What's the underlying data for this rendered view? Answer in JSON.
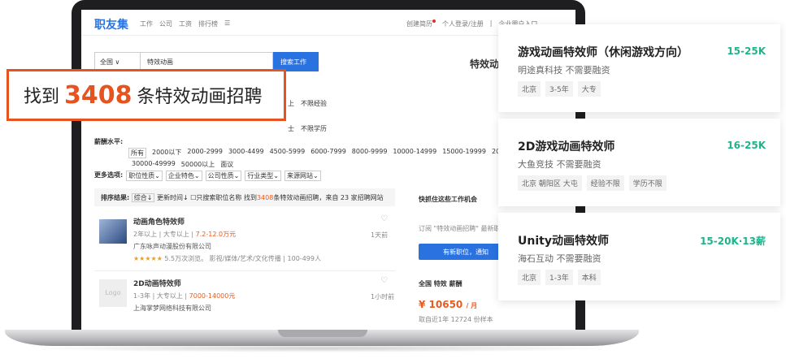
{
  "site": {
    "logo": "职友集",
    "nav": [
      "工作",
      "公司",
      "工资",
      "排行榜",
      "☰"
    ],
    "right": [
      "创建简历",
      "个人登录/注册",
      "|",
      "企业用户入口"
    ]
  },
  "search": {
    "city": "全国 ∨",
    "keyword": "特效动画",
    "button": "搜索工作",
    "right_title": "特效动"
  },
  "filters": {
    "exp_tail": [
      "上",
      "不限经验"
    ],
    "edu_tail": [
      "士",
      "不限学历"
    ],
    "salary_label": "薪酬水平:",
    "salary_row1": [
      "所有",
      "2000以下",
      "2000-2999",
      "3000-4499",
      "4500-5999",
      "6000-7999",
      "8000-9999",
      "10000-14999",
      "15000-19999",
      "200"
    ],
    "salary_row2": [
      "30000-49999",
      "50000以上",
      "面议"
    ],
    "more_label": "更多选项:",
    "more": [
      "职位性质⌄",
      "企业特色⌄",
      "公司性质⌄",
      "行业类型⌄",
      "来源网站⌄"
    ]
  },
  "sort": {
    "label": "排序结果:",
    "opt1": "综合↓",
    "opt2": "更新时间↓",
    "opt3": "☐只搜索职位名称",
    "found_pre": "找到",
    "found_num": "3408",
    "found_post": "条特效动画招聘，来自 23 家招聘网站"
  },
  "jobs": [
    {
      "title": "动画角色特效师",
      "req": "2年以上 | 大专以上 | ",
      "salary": "7.2-12.0万元",
      "company": "广东咏声动漫股份有限公司",
      "meta": "5.5万次浏览。 影视/媒体/艺术/文化传播 | 100-499人",
      "stars": "★★★★★",
      "time": "1天前",
      "heart": "♡"
    },
    {
      "title": "2D动画特效师",
      "req": "1-3年 | 大专以上 | ",
      "salary": "7000-14000元",
      "company": "上海掌梦网络科技有限公司",
      "time": "1小时前",
      "heart": "♡",
      "logo": "Logo"
    }
  ],
  "side": {
    "title": "快抓住这些工作机会",
    "desc": "订阅 \"特效动画招聘\" 最新职",
    "btn": "有新职位，通知",
    "sal_title": "全国 特效 薪酬",
    "sal_value": "¥ 10650",
    "sal_unit": "/ 月",
    "sal_note": "取自近1年 12724 份样本"
  },
  "callout": {
    "pre": "找到",
    "num": "3408",
    "post": "条特效动画招聘"
  },
  "cards": [
    {
      "title": "游戏动画特效师（休闲游戏方向）",
      "salary": "15-25K",
      "company": "明途真科技  不需要融资",
      "tags": [
        "北京",
        "3-5年",
        "大专"
      ]
    },
    {
      "title": "2D游戏动画特效师",
      "salary": "16-25K",
      "company": "大鱼竞技  不需要融资",
      "tags": [
        "北京 朝阳区 大屯",
        "经验不限",
        "学历不限"
      ]
    },
    {
      "title": "Unity动画特效师",
      "salary": "15-20K·13薪",
      "company": "海石互动  不需要融资",
      "tags": [
        "北京",
        "1-3年",
        "本科"
      ]
    }
  ]
}
